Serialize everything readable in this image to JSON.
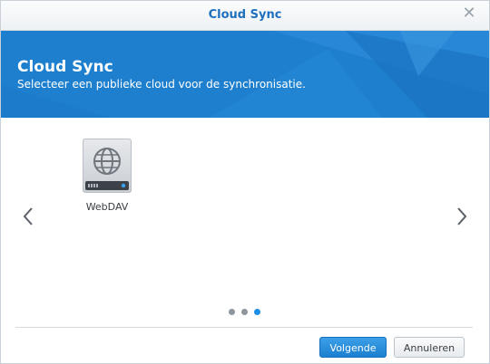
{
  "window": {
    "title": "Cloud Sync",
    "close_icon": "close-icon"
  },
  "banner": {
    "title": "Cloud Sync",
    "subtitle": "Selecteer een publieke cloud voor de synchronisatie.",
    "color": "#1e7fcf"
  },
  "providers": [
    {
      "label": "WebDAV",
      "icon": "globe-icon"
    }
  ],
  "pagination": {
    "pages": 3,
    "current": 3,
    "active_color": "#1b8ee6",
    "inactive_color": "#8e959c"
  },
  "nav": {
    "prev_icon": "chevron-left-icon",
    "next_icon": "chevron-right-icon"
  },
  "footer": {
    "next_label": "Volgende",
    "cancel_label": "Annuleren"
  }
}
